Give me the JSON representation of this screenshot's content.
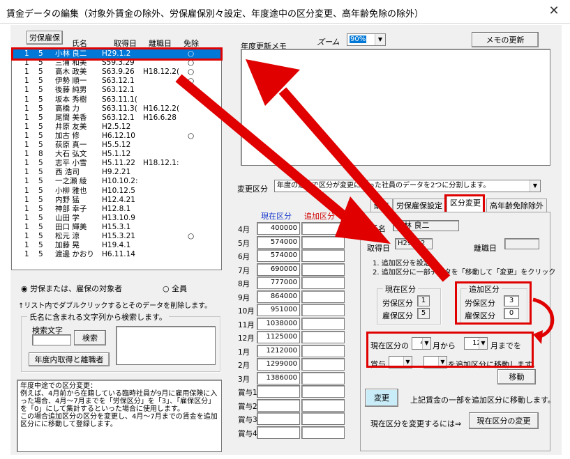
{
  "window": {
    "title": "賃金データの編集（対象外賃金の除外、労保雇保別々設定、年度途中の区分変更、高年齢免除の除外）",
    "close": "✕"
  },
  "list": {
    "header_button": "労保雇保",
    "headers": {
      "name": "氏名",
      "acquired": "取得日",
      "left": "離職日",
      "exempt": "免除"
    },
    "rows": [
      {
        "a": "1",
        "b": "5",
        "name": "小林 良二",
        "acq": "H29.1.2",
        "left": "",
        "ex": "○"
      },
      {
        "a": "1",
        "b": "5",
        "name": "三浦 和美",
        "acq": "S59.3.29",
        "left": "",
        "ex": "○"
      },
      {
        "a": "1",
        "b": "5",
        "name": "高木 政美",
        "acq": "S63.9.26",
        "left": "H18.12.2(",
        "ex": "○"
      },
      {
        "a": "1",
        "b": "5",
        "name": "伊勢 順一",
        "acq": "S63.12.1",
        "left": "",
        "ex": "○"
      },
      {
        "a": "1",
        "b": "5",
        "name": "後藤 純男",
        "acq": "S63.12.1",
        "left": "",
        "ex": ""
      },
      {
        "a": "1",
        "b": "5",
        "name": "坂本 秀樹",
        "acq": "S63.11.1(",
        "left": "",
        "ex": ""
      },
      {
        "a": "1",
        "b": "5",
        "name": "高橋 力",
        "acq": "S63.11.3(",
        "left": "H16.12.2(",
        "ex": ""
      },
      {
        "a": "1",
        "b": "5",
        "name": "尾間 美香",
        "acq": "S63.12.1",
        "left": "H16.6.28",
        "ex": ""
      },
      {
        "a": "1",
        "b": "5",
        "name": "井原 友美",
        "acq": "H2.5.12",
        "left": "",
        "ex": ""
      },
      {
        "a": "1",
        "b": "5",
        "name": "加古 修",
        "acq": "H6.12.10",
        "left": "",
        "ex": "○"
      },
      {
        "a": "1",
        "b": "5",
        "name": "荻原 真一",
        "acq": "H5.5.12",
        "left": "",
        "ex": ""
      },
      {
        "a": "1",
        "b": "8",
        "name": "大石 弘文",
        "acq": "H5.1.12",
        "left": "",
        "ex": ""
      },
      {
        "a": "1",
        "b": "5",
        "name": "志平 小雪",
        "acq": "H5.11.22",
        "left": "H18.12.1:",
        "ex": ""
      },
      {
        "a": "1",
        "b": "5",
        "name": "西 浩司",
        "acq": "H9.2.21",
        "left": "",
        "ex": ""
      },
      {
        "a": "1",
        "b": "5",
        "name": "一之瀬 綾",
        "acq": "H10.10.2:",
        "left": "",
        "ex": ""
      },
      {
        "a": "1",
        "b": "5",
        "name": "小柳 雅也",
        "acq": "H10.12.5",
        "left": "",
        "ex": ""
      },
      {
        "a": "1",
        "b": "5",
        "name": "内野 猛",
        "acq": "H12.4.21",
        "left": "",
        "ex": ""
      },
      {
        "a": "1",
        "b": "5",
        "name": "神部 幸子",
        "acq": "H12.8.1",
        "left": "",
        "ex": ""
      },
      {
        "a": "1",
        "b": "5",
        "name": "山田 学",
        "acq": "H13.10.9",
        "left": "",
        "ex": ""
      },
      {
        "a": "1",
        "b": "5",
        "name": "田口 輝美",
        "acq": "H15.3.1",
        "left": "",
        "ex": ""
      },
      {
        "a": "1",
        "b": "5",
        "name": "松元 涼",
        "acq": "H15.3.21",
        "left": "",
        "ex": "○"
      },
      {
        "a": "1",
        "b": "5",
        "name": "加藤 晃",
        "acq": "H19.4.1",
        "left": "",
        "ex": ""
      },
      {
        "a": "1",
        "b": "5",
        "name": "渡邊 かおり",
        "acq": "H6.11.14",
        "left": "",
        "ex": ""
      }
    ]
  },
  "filter": {
    "radio1": "労保または、雇保の対象者",
    "radio2": "全員",
    "note": "↑リスト内でダブルクリックするとそのデータを削除します。",
    "search_group": "氏名に含まれる文字列から検索します。",
    "search_label": "検索文字",
    "search_button": "検索",
    "search_value": "",
    "midyear_button": "年度内取得と離職者"
  },
  "description": "年度中途での区分変更：\n例えば、4月前から在籍している臨時社員が9月に雇用保険に入った場合、4月～7月までを「労保区分」を「3」、「雇保区分」を「0」にして集計するといった場合に使用します。\nこの場合追加区分の区分を変更し、4月～7月までの賃金を追加区分にに移動して登録します。",
  "memo": {
    "label": "年度更新メモ",
    "zoom_label": "ズーム",
    "zoom_value": "90%",
    "update_button": "メモの更新",
    "text": ""
  },
  "change": {
    "label": "変更区分",
    "value": "年度の途中で区分が変更になった社員のデータを2つに分割します。"
  },
  "wages": {
    "current_header": "現在区分",
    "additional_header": "追加区分",
    "months": [
      "4月",
      "5月",
      "6月",
      "7月",
      "8月",
      "9月",
      "10月",
      "11月",
      "12月",
      "1月",
      "2月",
      "3月",
      "賞与1",
      "賞与2",
      "賞与3",
      "賞与4"
    ],
    "current": [
      "400000",
      "574000",
      "574000",
      "690000",
      "777000",
      "864000",
      "951000",
      "1038000",
      "1125000",
      "1212000",
      "1299000",
      "1386000",
      "",
      "",
      "",
      ""
    ],
    "additional": [
      "",
      "",
      "",
      "",
      "",
      "",
      "",
      "",
      "",
      "",
      "",
      "",
      "",
      "",
      "",
      ""
    ]
  },
  "tabs": {
    "t1": "編集",
    "t2": "労保雇保設定",
    "t3": "区分変更",
    "t4": "高年齢免除除外"
  },
  "panel": {
    "name_label": "氏名",
    "name_value": "小林 良二",
    "acq_label": "取得日",
    "acq_value": "H29.1.2",
    "left_label": "離職日",
    "left_value": "",
    "inst1": "1. 追加区分を設定し",
    "inst2": "2. 追加区分に一部データを「移動して「変更」をクリック",
    "current_group": "現在区分",
    "add_group": "追加区分",
    "rou_label": "労保区分",
    "koyo_label": "雇保区分",
    "cur_rou": "1",
    "cur_koyo": "5",
    "add_rou": "3",
    "add_koyo": "0",
    "move_text1": "現在区分の",
    "from_month": "4",
    "from_text": "月から",
    "to_month": "12",
    "to_text": "月までを",
    "bonus_label": "賞与",
    "bonus_sep": "、",
    "bonus_tail": "を追加区分に移動します。",
    "move_button": "移動",
    "change_button": "変更",
    "change_text": "上記賃金の一部を追加区分に移動します。",
    "current_change_text": "現在区分を変更するには⇒",
    "current_change_button": "現在区分の変更"
  },
  "colors": {
    "highlight": "#e00000",
    "selection": "#0078d7",
    "header_blue": "#1a3bcc",
    "change_button": "#c8ecf8"
  }
}
